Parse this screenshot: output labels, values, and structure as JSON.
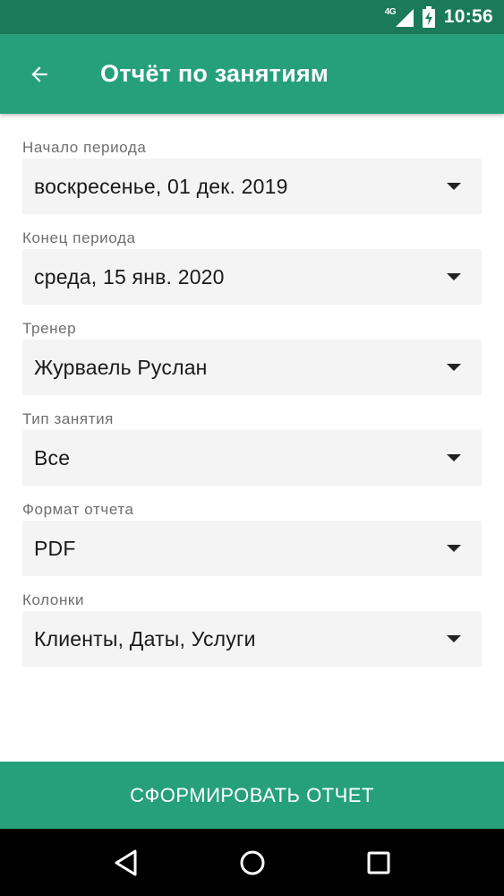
{
  "status_bar": {
    "network": "4G",
    "time": "10:56"
  },
  "app_bar": {
    "title": "Отчёт по занятиям",
    "back_icon": "arrow-left-icon"
  },
  "fields": [
    {
      "label": "Начало периода",
      "value": "воскресенье, 01 дек. 2019"
    },
    {
      "label": "Конец периода",
      "value": "среда, 15 янв. 2020"
    },
    {
      "label": "Тренер",
      "value": "Журваель Руслан"
    },
    {
      "label": "Тип занятия",
      "value": "Все"
    },
    {
      "label": "Формат отчета",
      "value": "PDF"
    },
    {
      "label": "Колонки",
      "value": "Клиенты, Даты, Услуги"
    }
  ],
  "submit_label": "СФОРМИРОВАТЬ ОТЧЕТ",
  "colors": {
    "status_bar": "#1a7a59",
    "primary": "#26a07a",
    "field_bg": "#f4f4f4",
    "label": "#6e6e6e"
  }
}
